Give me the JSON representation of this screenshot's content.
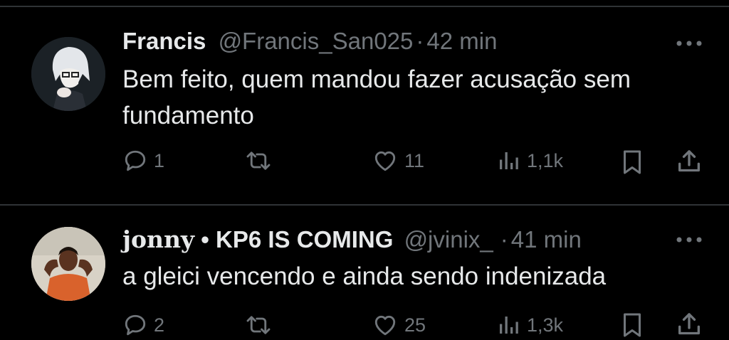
{
  "tweets": [
    {
      "display_name": "Francis",
      "handle": "@Francis_San025",
      "separator": "·",
      "time": "42 min",
      "text": "Bem feito, quem mandou fazer acusação sem fundamento",
      "avatar_icon": "anime-character-avatar",
      "stats": {
        "replies": "1",
        "retweets": "",
        "likes": "11",
        "views": "1,1k"
      }
    },
    {
      "display_name_part1": "jonny",
      "display_name_part2": "• KP6 IS COMING",
      "handle": "@jvinix_",
      "separator": "·",
      "time": "41 min",
      "text": "a gleici vencendo e ainda sendo indenizada",
      "avatar_icon": "person-photo-avatar",
      "stats": {
        "replies": "2",
        "retweets": "",
        "likes": "25",
        "views": "1,3k"
      }
    }
  ],
  "colors": {
    "background": "#000000",
    "text": "#e7e9ea",
    "muted": "#71767b",
    "divider": "#2f3336"
  }
}
